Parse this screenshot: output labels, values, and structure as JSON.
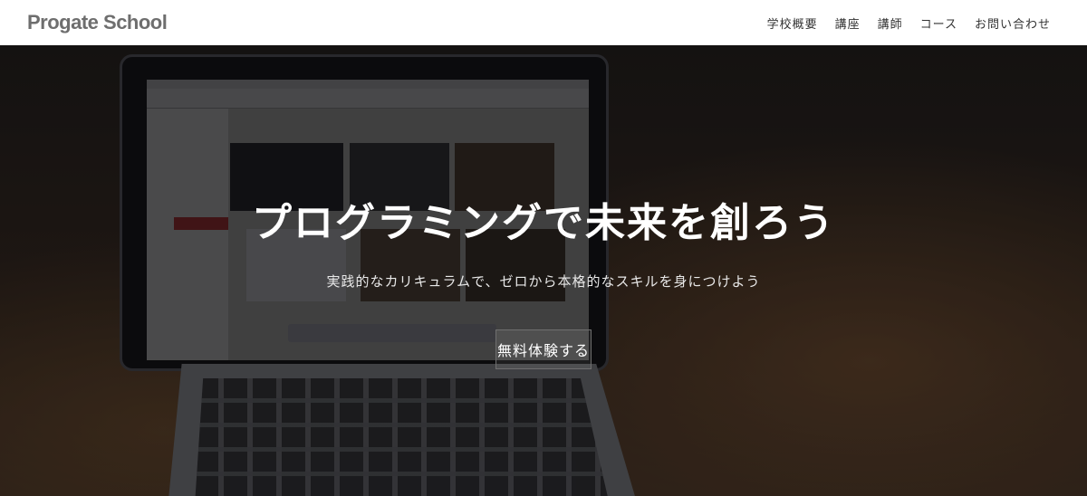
{
  "header": {
    "logo": "Progate School",
    "nav": [
      {
        "label": "学校概要"
      },
      {
        "label": "講座"
      },
      {
        "label": "講師"
      },
      {
        "label": "コース"
      },
      {
        "label": "お問い合わせ"
      }
    ]
  },
  "hero": {
    "title": "プログラミングで未来を創ろう",
    "subtitle": "実践的なカリキュラムで、ゼロから本格的なスキルを身につけよう",
    "button_label": "無料体験する"
  },
  "colors": {
    "header_bg": "#ffffff",
    "logo": "#6e6e6e",
    "hero_text": "#ffffff"
  }
}
